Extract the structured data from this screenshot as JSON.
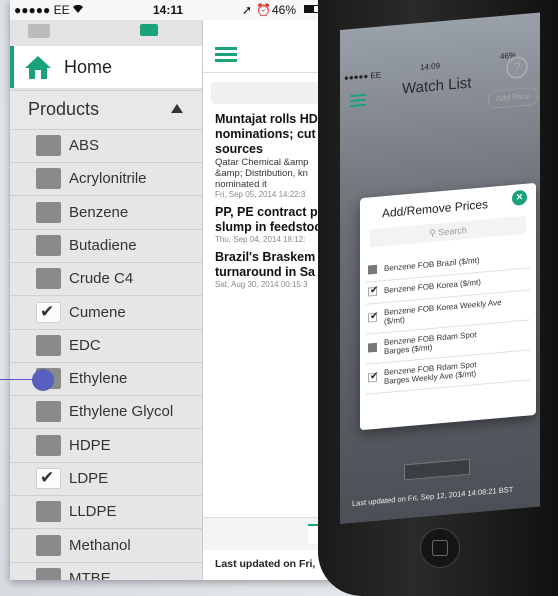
{
  "left_phone": {
    "status": {
      "carrier": "●●●●● EE",
      "wifi": "wifi-icon",
      "time": "14:11",
      "battery": "46%"
    },
    "sidebar": {
      "home_label": "Home",
      "products_label": "Products",
      "products": [
        {
          "label": "ABS",
          "checked": false
        },
        {
          "label": "Acrylonitrile",
          "checked": false
        },
        {
          "label": "Benzene",
          "checked": false
        },
        {
          "label": "Butadiene",
          "checked": false
        },
        {
          "label": "Crude C4",
          "checked": false
        },
        {
          "label": "Cumene",
          "checked": true
        },
        {
          "label": "EDC",
          "checked": false
        },
        {
          "label": "Ethylene",
          "checked": false
        },
        {
          "label": "Ethylene Glycol",
          "checked": false
        },
        {
          "label": "HDPE",
          "checked": false
        },
        {
          "label": "LDPE",
          "checked": true
        },
        {
          "label": "LLDPE",
          "checked": false
        },
        {
          "label": "Methanol",
          "checked": false
        },
        {
          "label": "MTBE",
          "checked": false
        }
      ]
    },
    "news": {
      "items": [
        {
          "title": "Muntajat rolls HD\nnominations; cut\nsources",
          "snippet": "Qatar Chemical &amp\n&amp; Distribution, kn\nnominated it",
          "date": "Fri, Sep 05, 2014 14:22:3"
        },
        {
          "title": "PP, PE contract p\nslump in feedstoc",
          "snippet": "",
          "date": "Thu, Sep 04, 2014 18:12:"
        },
        {
          "title": "Brazil's Braskem\nturnaround in Sa",
          "snippet": "",
          "date": "Sat, Aug 30, 2014 00:15:3"
        }
      ],
      "footer": "Last updated on Fri,"
    }
  },
  "right_phone": {
    "status": {
      "carrier": "●●●●● EE",
      "time": "14:09",
      "battery": "46%"
    },
    "title": "Watch List",
    "add_price_label": "Add Price",
    "dialog": {
      "title": "Add/Remove Prices",
      "search_placeholder": "Search",
      "items": [
        {
          "label": "Benzene FOB Brazil ($/mt)",
          "checked": false
        },
        {
          "label": "Benzene FOB Korea ($/mt)",
          "checked": true
        },
        {
          "label": "Benzene FOB Korea Weekly Ave\n($/mt)",
          "checked": true
        },
        {
          "label": "Benzene FOB Rdam Spot\nBarges ($/mt)",
          "checked": false
        },
        {
          "label": "Benzene FOB Rdam Spot\nBarges Weekly Ave ($/mt)",
          "checked": true
        }
      ]
    },
    "footer": "Last updated on Fri, Sep 12, 2014 14:08:21 BST"
  },
  "colors": {
    "accent": "#1aa37a",
    "pointer": "#5a5fbf"
  }
}
